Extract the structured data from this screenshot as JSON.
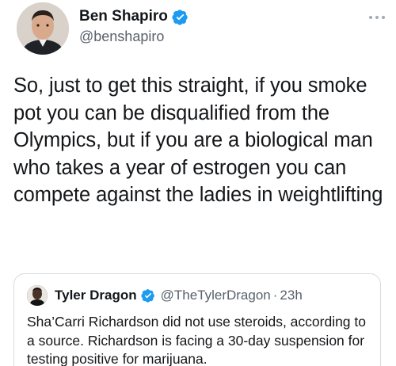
{
  "tweet": {
    "author": {
      "display_name": "Ben Shapiro",
      "handle": "@benshapiro",
      "verified": true
    },
    "text": "So, just to get this straight, if you smoke pot you can be disqualified from the Olympics, but if you are a biological man who takes a year of estrogen you can compete against the ladies in weightlifting",
    "more_icon": "more-horizontal-icon"
  },
  "quoted_tweet": {
    "author": {
      "display_name": "Tyler Dragon",
      "handle": "@TheTylerDragon",
      "verified": true
    },
    "separator": "·",
    "time": "23h",
    "text": "Sha’Carri Richardson did not use steroids, according to a source. Richardson is facing a 30-day suspension for testing positive for marijuana."
  },
  "colors": {
    "verified_blue": "#1d9bf0",
    "secondary_text": "#59616b",
    "border": "#d6dbe0"
  }
}
